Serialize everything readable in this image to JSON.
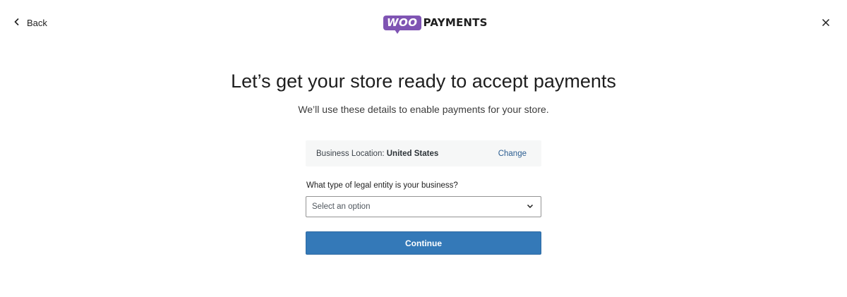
{
  "header": {
    "back_label": "Back",
    "logo_bubble": "WOO",
    "logo_text": "PAYMENTS"
  },
  "main": {
    "title": "Let’s get your store ready to accept payments",
    "subtitle": "We’ll use these details to enable payments for your store.",
    "location": {
      "label": "Business Location:",
      "value": "United States",
      "change_label": "Change"
    },
    "entity": {
      "label": "What type of legal entity is your business?",
      "selected": "Select an option"
    },
    "continue_label": "Continue"
  },
  "colors": {
    "brand": "#7f54b3",
    "primary_button": "#3479b8",
    "link": "#2c5e91",
    "panel_bg": "#f6f7f7"
  },
  "icons": {
    "back": "chevron-left-icon",
    "close": "close-icon",
    "select": "chevron-down-icon"
  }
}
